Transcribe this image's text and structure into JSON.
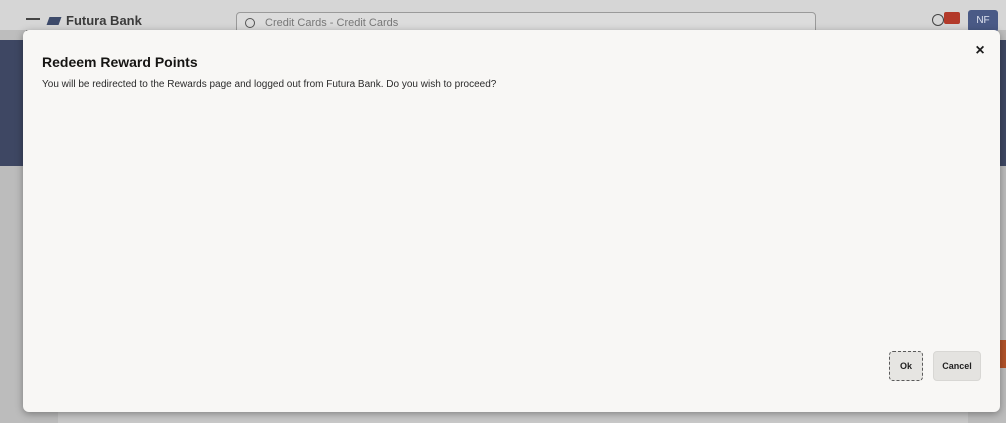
{
  "background_app": {
    "brand_name": "Futura Bank",
    "search_placeholder": "Credit Cards - Credit Cards",
    "avatar_initials": "NF"
  },
  "modal": {
    "title": "Redeem Reward Points",
    "message": "You will be redirected to the Rewards page and logged out from Futura Bank. Do you wish to proceed?",
    "close_icon": "×",
    "ok_label": "Ok",
    "cancel_label": "Cancel"
  },
  "colors": {
    "nav_band": "#3e4763",
    "modal_bg": "#f8f7f5",
    "badge": "#b33a2a",
    "accent_orange": "#b3532a"
  }
}
